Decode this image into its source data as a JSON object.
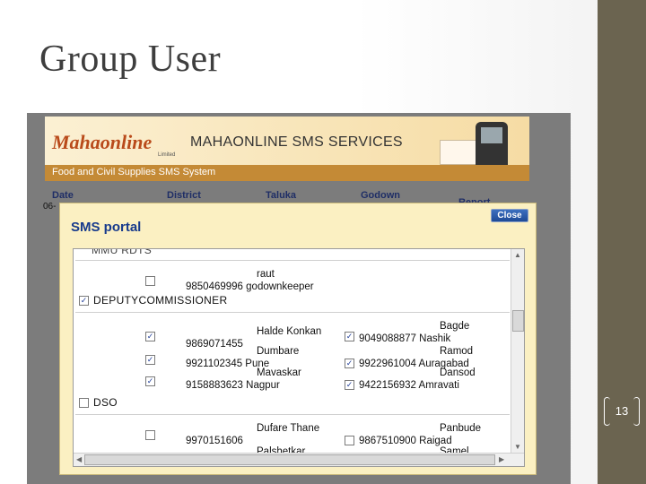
{
  "slide": {
    "title": "Group User",
    "page_number": "13"
  },
  "header": {
    "logo_text": "Mahaonline",
    "logo_sub": "Limited",
    "service_title": "MAHAONLINE SMS SERVICES",
    "system_title": "Food and Civil Supplies SMS System"
  },
  "columns": {
    "date": "Date",
    "district": "District",
    "taluka": "Taluka",
    "godown": "Godown",
    "report": "Report"
  },
  "left_fragment": "06-",
  "modal": {
    "title": "SMS portal",
    "close_label": "Close",
    "cut_top": "MMU RDTS",
    "rows": [
      {
        "name": "raut",
        "phone_role": "9850469996 godownkeeper",
        "checked": false
      },
      {
        "group": "DEPUTYCOMMISSIONER",
        "checked": true
      },
      {
        "name": "Halde Konkan",
        "phone": "9869071455",
        "checked": true,
        "name2": "Bagde",
        "phone2": "9049088877 Nashik",
        "checked2": true
      },
      {
        "name": "Dumbare",
        "phone": "9921102345 Pune",
        "checked": true,
        "name2": "Ramod",
        "phone2": "9922961004 Auragabad",
        "checked2": true
      },
      {
        "name": "Mavaskar",
        "phone": "9158883623 Nagpur",
        "checked": true,
        "name2": "Dansod",
        "phone2": "9422156932 Amravati",
        "checked2": true
      },
      {
        "group": "DSO",
        "checked": false
      },
      {
        "name": "Dufare Thane",
        "phone": "9970151606",
        "checked": false,
        "name2": "Panbude",
        "phone2": "9867510900 Raigad",
        "checked2": false
      },
      {
        "name": "Palshetkar",
        "checked": false,
        "name2": "Samel",
        "checked2": false
      }
    ]
  },
  "colors": {
    "slide_bar": "#6b6450",
    "modal_bg": "#fbf0c2",
    "modal_title": "#173a8c",
    "header_band": "#c48a36"
  },
  "icons": [
    "mail-envelope-icon",
    "mobile-phone-icon",
    "checkbox-icon",
    "scroll-arrow-icon"
  ]
}
